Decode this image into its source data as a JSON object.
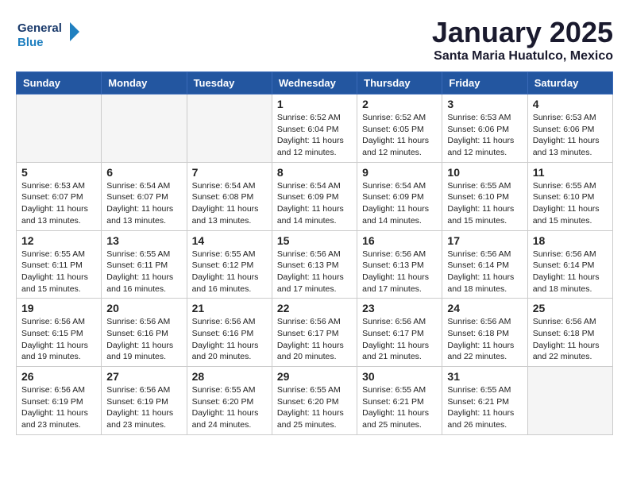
{
  "header": {
    "logo_line1": "General",
    "logo_line2": "Blue",
    "month": "January 2025",
    "location": "Santa Maria Huatulco, Mexico"
  },
  "weekdays": [
    "Sunday",
    "Monday",
    "Tuesday",
    "Wednesday",
    "Thursday",
    "Friday",
    "Saturday"
  ],
  "weeks": [
    [
      {
        "day": "",
        "empty": true
      },
      {
        "day": "",
        "empty": true
      },
      {
        "day": "",
        "empty": true
      },
      {
        "day": "1",
        "sunrise": "6:52 AM",
        "sunset": "6:04 PM",
        "daylight": "11 hours and 12 minutes."
      },
      {
        "day": "2",
        "sunrise": "6:52 AM",
        "sunset": "6:05 PM",
        "daylight": "11 hours and 12 minutes."
      },
      {
        "day": "3",
        "sunrise": "6:53 AM",
        "sunset": "6:06 PM",
        "daylight": "11 hours and 12 minutes."
      },
      {
        "day": "4",
        "sunrise": "6:53 AM",
        "sunset": "6:06 PM",
        "daylight": "11 hours and 13 minutes."
      }
    ],
    [
      {
        "day": "5",
        "sunrise": "6:53 AM",
        "sunset": "6:07 PM",
        "daylight": "11 hours and 13 minutes."
      },
      {
        "day": "6",
        "sunrise": "6:54 AM",
        "sunset": "6:07 PM",
        "daylight": "11 hours and 13 minutes."
      },
      {
        "day": "7",
        "sunrise": "6:54 AM",
        "sunset": "6:08 PM",
        "daylight": "11 hours and 13 minutes."
      },
      {
        "day": "8",
        "sunrise": "6:54 AM",
        "sunset": "6:09 PM",
        "daylight": "11 hours and 14 minutes."
      },
      {
        "day": "9",
        "sunrise": "6:54 AM",
        "sunset": "6:09 PM",
        "daylight": "11 hours and 14 minutes."
      },
      {
        "day": "10",
        "sunrise": "6:55 AM",
        "sunset": "6:10 PM",
        "daylight": "11 hours and 15 minutes."
      },
      {
        "day": "11",
        "sunrise": "6:55 AM",
        "sunset": "6:10 PM",
        "daylight": "11 hours and 15 minutes."
      }
    ],
    [
      {
        "day": "12",
        "sunrise": "6:55 AM",
        "sunset": "6:11 PM",
        "daylight": "11 hours and 15 minutes."
      },
      {
        "day": "13",
        "sunrise": "6:55 AM",
        "sunset": "6:11 PM",
        "daylight": "11 hours and 16 minutes."
      },
      {
        "day": "14",
        "sunrise": "6:55 AM",
        "sunset": "6:12 PM",
        "daylight": "11 hours and 16 minutes."
      },
      {
        "day": "15",
        "sunrise": "6:56 AM",
        "sunset": "6:13 PM",
        "daylight": "11 hours and 17 minutes."
      },
      {
        "day": "16",
        "sunrise": "6:56 AM",
        "sunset": "6:13 PM",
        "daylight": "11 hours and 17 minutes."
      },
      {
        "day": "17",
        "sunrise": "6:56 AM",
        "sunset": "6:14 PM",
        "daylight": "11 hours and 18 minutes."
      },
      {
        "day": "18",
        "sunrise": "6:56 AM",
        "sunset": "6:14 PM",
        "daylight": "11 hours and 18 minutes."
      }
    ],
    [
      {
        "day": "19",
        "sunrise": "6:56 AM",
        "sunset": "6:15 PM",
        "daylight": "11 hours and 19 minutes."
      },
      {
        "day": "20",
        "sunrise": "6:56 AM",
        "sunset": "6:16 PM",
        "daylight": "11 hours and 19 minutes."
      },
      {
        "day": "21",
        "sunrise": "6:56 AM",
        "sunset": "6:16 PM",
        "daylight": "11 hours and 20 minutes."
      },
      {
        "day": "22",
        "sunrise": "6:56 AM",
        "sunset": "6:17 PM",
        "daylight": "11 hours and 20 minutes."
      },
      {
        "day": "23",
        "sunrise": "6:56 AM",
        "sunset": "6:17 PM",
        "daylight": "11 hours and 21 minutes."
      },
      {
        "day": "24",
        "sunrise": "6:56 AM",
        "sunset": "6:18 PM",
        "daylight": "11 hours and 22 minutes."
      },
      {
        "day": "25",
        "sunrise": "6:56 AM",
        "sunset": "6:18 PM",
        "daylight": "11 hours and 22 minutes."
      }
    ],
    [
      {
        "day": "26",
        "sunrise": "6:56 AM",
        "sunset": "6:19 PM",
        "daylight": "11 hours and 23 minutes."
      },
      {
        "day": "27",
        "sunrise": "6:56 AM",
        "sunset": "6:19 PM",
        "daylight": "11 hours and 23 minutes."
      },
      {
        "day": "28",
        "sunrise": "6:55 AM",
        "sunset": "6:20 PM",
        "daylight": "11 hours and 24 minutes."
      },
      {
        "day": "29",
        "sunrise": "6:55 AM",
        "sunset": "6:20 PM",
        "daylight": "11 hours and 25 minutes."
      },
      {
        "day": "30",
        "sunrise": "6:55 AM",
        "sunset": "6:21 PM",
        "daylight": "11 hours and 25 minutes."
      },
      {
        "day": "31",
        "sunrise": "6:55 AM",
        "sunset": "6:21 PM",
        "daylight": "11 hours and 26 minutes."
      },
      {
        "day": "",
        "empty": true
      }
    ]
  ]
}
